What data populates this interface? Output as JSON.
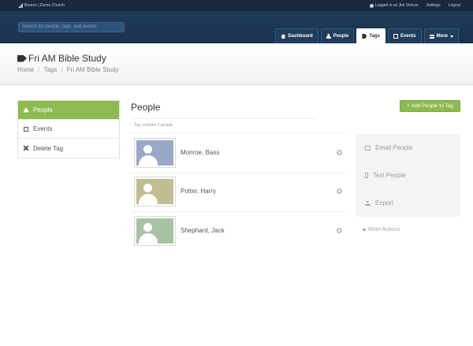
{
  "topbar": {
    "brand": "Breeze | Demo Church",
    "logged_in": "Logged in as Jim VerLee",
    "settings": "Settings",
    "logout": "Logout"
  },
  "search": {
    "placeholder": "Search for people, tags, and events"
  },
  "nav": {
    "tabs": [
      {
        "label": "Dashboard",
        "icon": "home-icon"
      },
      {
        "label": "People",
        "icon": "person-icon"
      },
      {
        "label": "Tags",
        "icon": "tag-icon",
        "active": true
      },
      {
        "label": "Events",
        "icon": "calendar-icon"
      },
      {
        "label": "More",
        "icon": "menu-icon"
      }
    ]
  },
  "page": {
    "title": "Fri AM Bible Study",
    "breadcrumb": [
      "Home",
      "Tags",
      "Fri AM Bible Study"
    ]
  },
  "sidebar": {
    "items": [
      {
        "label": "People",
        "icon": "person-icon",
        "active": true
      },
      {
        "label": "Events",
        "icon": "calendar-icon"
      },
      {
        "label": "Delete Tag",
        "icon": "close-icon"
      }
    ]
  },
  "main": {
    "heading": "People",
    "add_button": "Add People to Tag",
    "tag_count": "Tag contains 3 people.",
    "people": [
      {
        "name": "Monroe, Bass",
        "photo_color": "#9aa8c8"
      },
      {
        "name": "Potter, Harry",
        "photo_color": "#c1bd93"
      },
      {
        "name": "Shephard, Jack",
        "photo_color": "#a8c3a3"
      }
    ]
  },
  "actions": {
    "items": [
      {
        "label": "Email People",
        "icon": "envelope-icon"
      },
      {
        "label": "Text People",
        "icon": "phone-icon"
      },
      {
        "label": "Export",
        "icon": "download-icon"
      }
    ],
    "more": "More Actions"
  },
  "colors": {
    "accent": "#8cbb4f",
    "header": "#1f3a57",
    "topbar": "#17293b"
  }
}
